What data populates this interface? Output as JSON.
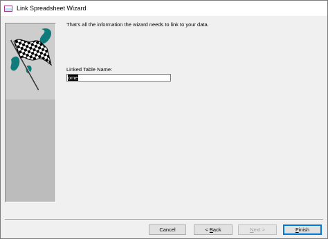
{
  "window": {
    "title": "Link Spreadsheet Wizard",
    "icon": "access-app-icon"
  },
  "art": {
    "icon": "checkered-flag-icon",
    "colors": {
      "flag_dark": "#000000",
      "swoosh": "#0f7b7b",
      "panel": "#bcbcbc"
    }
  },
  "main": {
    "message": "That's all the information the wizard needs to link to your data.",
    "linked_table_label": "Linked Table Name:",
    "linked_table_value": "ome"
  },
  "buttons": {
    "cancel": "Cancel",
    "back_prefix": "< ",
    "back_mnemonic": "B",
    "back_rest": "ack",
    "next_mnemonic": "N",
    "next_rest": "ext >",
    "finish_mnemonic": "F",
    "finish_rest": "inish",
    "states": {
      "next": "disabled",
      "finish": "default"
    }
  },
  "colors": {
    "accent": "#0078d7",
    "disabled_text": "#a0a0a0"
  }
}
